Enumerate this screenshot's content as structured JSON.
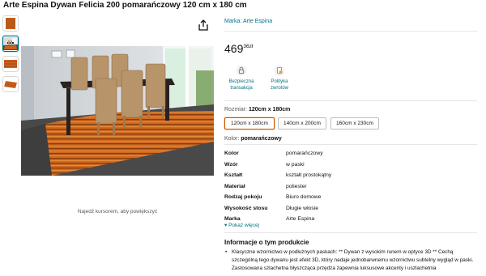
{
  "product": {
    "title": "Arte Espina Dywan Felicia 200 pomarańczowy 120 cm x 180 cm",
    "brand_link": "Marka: Arte Espina"
  },
  "price": {
    "whole": "469",
    "fraction": "36",
    "currency": "zł"
  },
  "features": [
    {
      "icon": "lock-icon",
      "label": "Bezpieczna transakcja"
    },
    {
      "icon": "return-policy-icon",
      "label": "Polityka zwrotów"
    }
  ],
  "size": {
    "label": "Rozmiar:",
    "selected": "120cm x 180cm",
    "options": [
      "120cm x 180cm",
      "140cm x 200cm",
      "160cm x 230cm"
    ]
  },
  "color": {
    "label": "Kolor:",
    "selected": "pomarańczowy"
  },
  "specs": [
    {
      "key": "Kolor",
      "value": "pomarańczowy"
    },
    {
      "key": "Wzór",
      "value": "w paski"
    },
    {
      "key": "Kształt",
      "value": "kształt prostokątny"
    },
    {
      "key": "Materiał",
      "value": "poliester"
    },
    {
      "key": "Rodzaj pokoju",
      "value": "Biuro domowe"
    },
    {
      "key": "Wysokość stosu",
      "value": "Długie włosie"
    },
    {
      "key": "Marka",
      "value": "Arte Espina"
    }
  ],
  "show_more": "▾ Pokaż więcej",
  "gallery": {
    "zoom_hint": "Najedź kursorem, aby powiększyć",
    "thumbnail_count": 4
  },
  "about": {
    "title": "Informacje o tym produkcie",
    "bullets": [
      "Klasyczne wzornictwo w podłużnych paskach: ** Dywan z wysokim runem w optyce 3D ** Cechą szczególną tego dywanu jest efekt 3D, który nadaje jednobarwnemu wzornictwu subtelny wygląd w paski. Zastosowana szlachetna błyszcząca przędza zapewnia luksusowe akcenty i uszlachetnia"
    ]
  },
  "colors": {
    "link": "#007185",
    "selected_border": "#c45500",
    "rug": "#d2691e"
  }
}
